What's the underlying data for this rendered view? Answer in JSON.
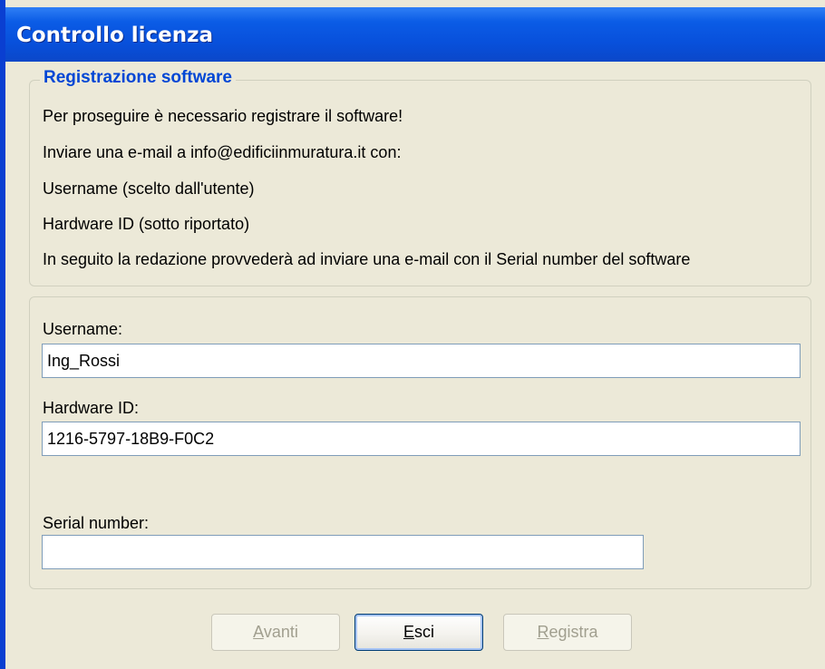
{
  "window": {
    "title": "Controllo licenza"
  },
  "info_group": {
    "legend": "Registrazione software",
    "lines": [
      "Per proseguire è necessario registrare il software!",
      "Inviare una e-mail a info@edificiinmuratura.it con:",
      "Username (scelto dall'utente)",
      "Hardware ID (sotto riportato)",
      "In seguito la redazione provvederà ad inviare una e-mail con il Serial number del software"
    ]
  },
  "form": {
    "username_label": "Username:",
    "username_value": "Ing_Rossi",
    "hardware_label": "Hardware ID:",
    "hardware_value": "1216-5797-18B9-F0C2",
    "serial_label": "Serial number:",
    "serial_value": ""
  },
  "buttons": {
    "avanti": {
      "mnemonic": "A",
      "rest": "vanti",
      "enabled": false
    },
    "esci": {
      "mnemonic": "E",
      "rest": "sci",
      "enabled": true
    },
    "registra": {
      "mnemonic": "R",
      "rest": "egistra",
      "enabled": false
    }
  },
  "colors": {
    "titlebar": "#0a5ee8",
    "legend": "#0046d5",
    "dialog_bg": "#ece9d8"
  }
}
